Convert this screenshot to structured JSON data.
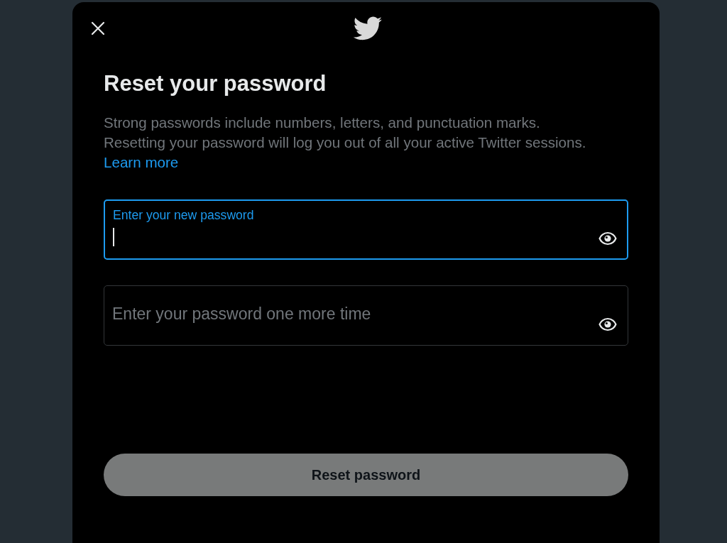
{
  "dialog": {
    "title": "Reset your password",
    "description": {
      "text": "Strong passwords include numbers, letters, and punctuation marks.\nResetting your password will log you out of all your active Twitter sessions.",
      "link": "Learn more"
    },
    "fields": [
      {
        "label": "Enter your new password",
        "focused": true
      },
      {
        "label": "Enter your password one more time",
        "focused": false
      }
    ],
    "submit_button": {
      "label": "Reset password",
      "disabled": true
    }
  }
}
